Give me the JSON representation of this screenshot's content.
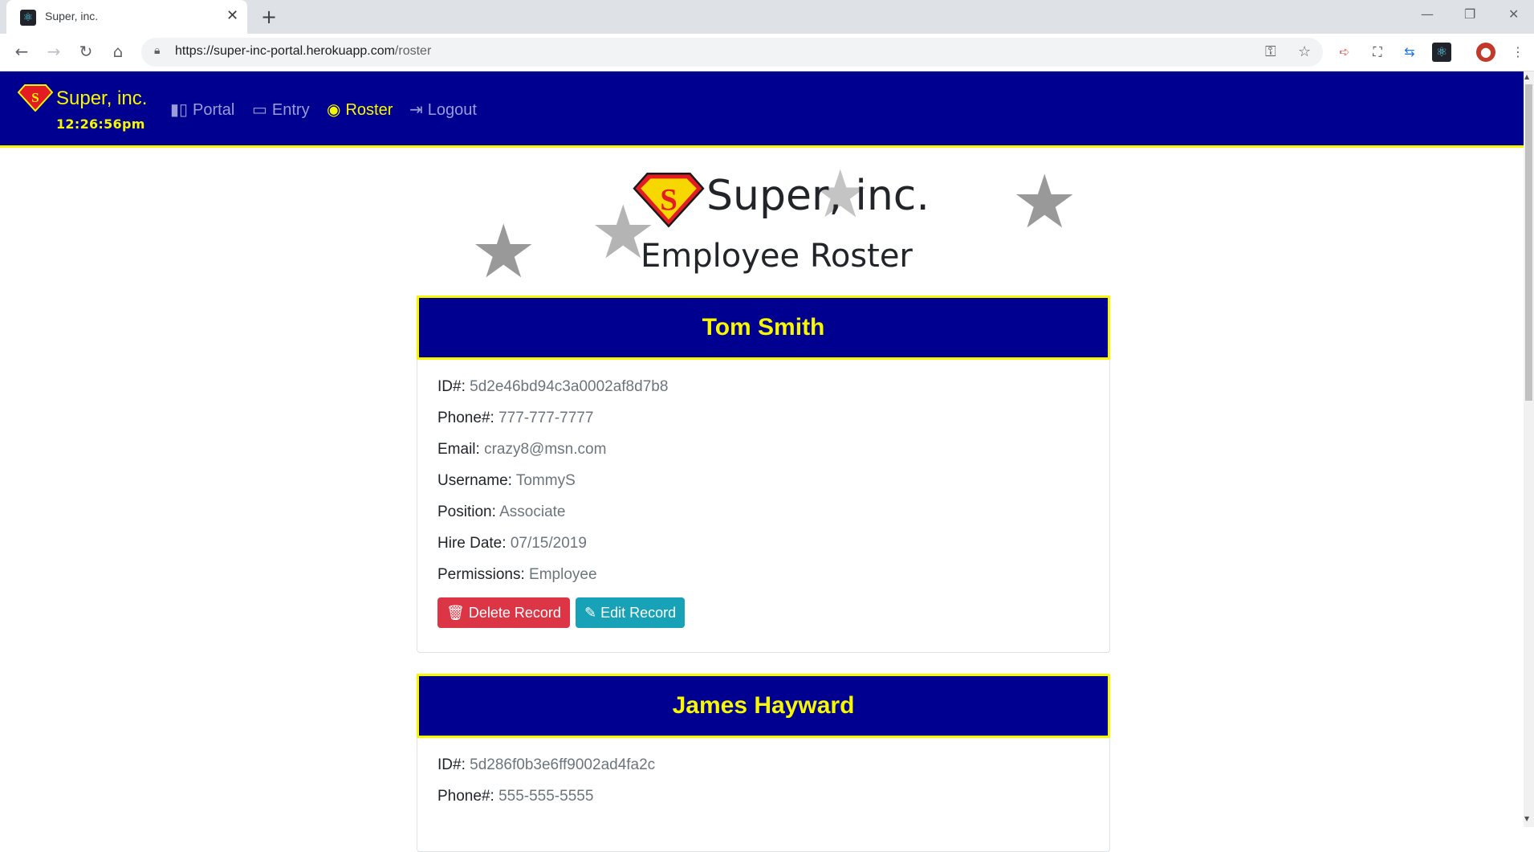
{
  "browser": {
    "tab_title": "Super, inc.",
    "url_host": "https://super-inc-portal.herokuapp.com",
    "url_path": "/roster"
  },
  "navbar": {
    "brand": "Super, inc.",
    "clock": "12:26:56pm",
    "links": [
      {
        "label": "Portal",
        "icon": "building-icon",
        "active": false
      },
      {
        "label": "Entry",
        "icon": "id-card-icon",
        "active": false
      },
      {
        "label": "Roster",
        "icon": "eye-icon",
        "active": true
      },
      {
        "label": "Logout",
        "icon": "sign-out-icon",
        "active": false
      }
    ]
  },
  "hero": {
    "title": "Super, inc.",
    "subtitle": "Employee Roster"
  },
  "employees": [
    {
      "name": "Tom Smith",
      "fields": [
        {
          "label": "ID#:",
          "value": "5d2e46bd94c3a0002af8d7b8"
        },
        {
          "label": "Phone#:",
          "value": "777-777-7777"
        },
        {
          "label": "Email:",
          "value": "crazy8@msn.com"
        },
        {
          "label": "Username:",
          "value": "TommyS"
        },
        {
          "label": "Position:",
          "value": "Associate"
        },
        {
          "label": "Hire Date:",
          "value": "07/15/2019"
        },
        {
          "label": "Permissions:",
          "value": "Employee"
        }
      ],
      "delete_label": "Delete Record",
      "edit_label": "Edit Record"
    },
    {
      "name": "James Hayward",
      "fields": [
        {
          "label": "ID#:",
          "value": "5d286f0b3e6ff9002ad4fa2c"
        },
        {
          "label": "Phone#:",
          "value": "555-555-5555"
        }
      ]
    }
  ],
  "colors": {
    "navbar_bg": "#000090",
    "accent_yellow": "#f7f700",
    "danger": "#dc3545",
    "info": "#17a2b8"
  }
}
